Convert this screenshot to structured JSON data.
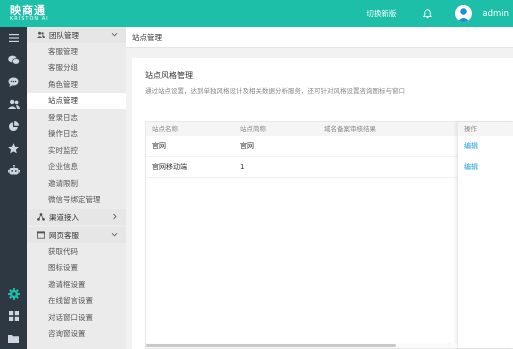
{
  "header": {
    "logo_main": "映商通",
    "logo_sub": "KRISTON AI",
    "switch_label": "切换新版",
    "user_name": "admin",
    "color": "#1dbfa8"
  },
  "rail": {
    "items": [
      "menu-icon",
      "wechat-icon",
      "chat-icon",
      "users-icon",
      "pie-chart-icon",
      "star-icon",
      "robot-icon",
      "gear-icon",
      "grid-icon",
      "folder-icon"
    ]
  },
  "subnav": {
    "groups": [
      {
        "label": "团队管理",
        "items": [
          "客服管理",
          "客服分组",
          "角色管理",
          "站点管理",
          "登录日志",
          "操作日志",
          "实时监控",
          "企业信息",
          "邀请限制",
          "微信号绑定管理"
        ]
      },
      {
        "label": "渠道接入",
        "items": []
      },
      {
        "label": "网页客服",
        "items": [
          "获取代码",
          "图标设置",
          "邀请框设置",
          "在线留言设置",
          "对话窗口设置",
          "咨询窗设置"
        ]
      }
    ],
    "active": "站点管理"
  },
  "breadcrumb": "站点管理",
  "panel": {
    "title": "站点风格管理",
    "description": "通过站点设置，达到单独风格设计及相关数据分析服务，还可针对风格设置咨询图标与窗口"
  },
  "table": {
    "columns": [
      "站点名称",
      "站点简称",
      "域名备案审核结果",
      "操作"
    ],
    "rows": [
      {
        "name": "官网",
        "short": "官网",
        "audit": "",
        "action": "编辑"
      },
      {
        "name": "官网移动端",
        "short": "1",
        "audit": "",
        "action": "编辑"
      }
    ]
  }
}
